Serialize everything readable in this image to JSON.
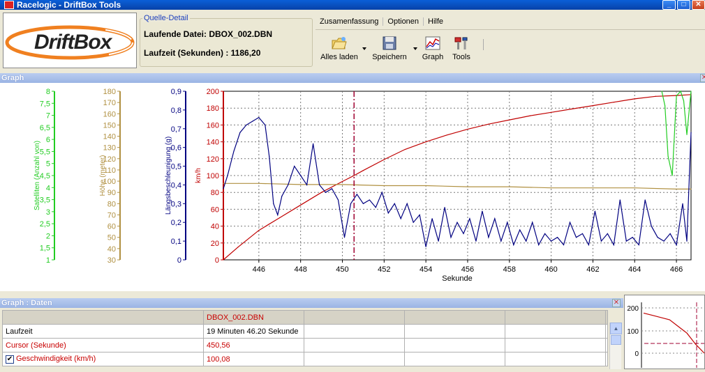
{
  "window": {
    "title": "Racelogic - DriftBox Tools",
    "min": "_",
    "max": "□",
    "close": "✕"
  },
  "logo": {
    "text": "DriftBox"
  },
  "quelle": {
    "legend": "Quelle-Detail",
    "file_line": "Laufende Datei: DBOX_002.DBN",
    "time_line": "Laufzeit (Sekunden) : 1186,20"
  },
  "menu": [
    "Zusamenfassung",
    "Optionen",
    "Hilfe"
  ],
  "toolbar": {
    "load": "Alles laden",
    "save": "Speichern",
    "graph": "Graph",
    "tools": "Tools",
    "load_icon": "folder-icon",
    "save_icon": "floppy-icon",
    "graph_icon": "graph-icon",
    "tools_icon": "tools-icon"
  },
  "graph_panel": {
    "title": "Graph",
    "close": "✕"
  },
  "daten_panel": {
    "title": "Graph : Daten",
    "close": "✕"
  },
  "colors": {
    "satellites": "#22cc22",
    "height": "#b09040",
    "accel": "#000080",
    "speed": "#c00000"
  },
  "chart_data": {
    "type": "line",
    "xlabel": "Sekunde",
    "xlim": [
      444.3,
      466.7
    ],
    "x_ticks": [
      "446",
      "448",
      "450",
      "452",
      "454",
      "456",
      "458",
      "460",
      "462",
      "464",
      "466"
    ],
    "cursor_x": 450.56,
    "axes": [
      {
        "name": "Satelliten (Anzahl von)",
        "color": "#22cc22",
        "ylim": [
          1,
          8
        ],
        "ticks": [
          "1",
          "1,5",
          "2",
          "2,5",
          "3",
          "3,5",
          "4",
          "4,5",
          "5",
          "5,5",
          "6",
          "6,5",
          "7",
          "7,5",
          "8"
        ]
      },
      {
        "name": "Höhe (meter)",
        "color": "#b09040",
        "ylim": [
          30,
          180
        ],
        "ticks": [
          "30",
          "40",
          "50",
          "60",
          "70",
          "80",
          "90",
          "100",
          "110",
          "120",
          "130",
          "140",
          "150",
          "160",
          "170",
          "180"
        ]
      },
      {
        "name": "Längsbeschleunigung (g)",
        "color": "#000080",
        "ylim": [
          0,
          0.9
        ],
        "ticks": [
          "0",
          "0,1",
          "0,2",
          "0,3",
          "0,4",
          "0,5",
          "0,6",
          "0,7",
          "0,8",
          "0,9"
        ]
      },
      {
        "name": "km/h",
        "color": "#c00000",
        "ylim": [
          0,
          200
        ],
        "ticks": [
          "0",
          "20",
          "40",
          "60",
          "80",
          "100",
          "120",
          "140",
          "160",
          "180",
          "200"
        ]
      }
    ],
    "series": [
      {
        "name": "Geschwindigkeit",
        "axis": 3,
        "color": "#c00000",
        "x": [
          444.3,
          445,
          446,
          447,
          448,
          449,
          450,
          450.56,
          451,
          452,
          453,
          454,
          455,
          456,
          457,
          458,
          459,
          460,
          461,
          462,
          463,
          464,
          465,
          466,
          466.7
        ],
        "y": [
          0,
          15,
          35,
          50,
          65,
          80,
          93,
          100,
          106,
          119,
          131,
          140,
          148,
          155,
          161,
          166,
          171,
          175,
          179,
          183,
          187,
          191,
          194,
          195,
          196
        ]
      },
      {
        "name": "Höhe",
        "axis": 1,
        "color": "#b09040",
        "x": [
          444.3,
          446,
          448,
          450,
          452,
          454,
          456,
          458,
          460,
          462,
          464,
          466,
          466.7
        ],
        "y": [
          98,
          98,
          97,
          97,
          96,
          96,
          95,
          95,
          94,
          94,
          94,
          93,
          93
        ]
      },
      {
        "name": "Satelliten",
        "axis": 0,
        "color": "#22cc22",
        "x": [
          465.3,
          465.45,
          465.6,
          465.8,
          466,
          466.2,
          466.35,
          466.5,
          466.7
        ],
        "y": [
          8,
          7.4,
          5.3,
          4.5,
          7.8,
          8,
          7.6,
          6.2,
          8
        ]
      },
      {
        "name": "Längsbeschleunigung",
        "axis": 2,
        "color": "#000080",
        "x": [
          444.3,
          444.5,
          444.8,
          445.1,
          445.4,
          445.7,
          446,
          446.3,
          446.5,
          446.7,
          446.9,
          447.1,
          447.4,
          447.7,
          448,
          448.3,
          448.6,
          448.9,
          449.2,
          449.5,
          449.8,
          450.1,
          450.4,
          450.7,
          451,
          451.3,
          451.6,
          451.9,
          452.2,
          452.5,
          452.8,
          453.1,
          453.4,
          453.7,
          454,
          454.3,
          454.6,
          454.9,
          455.2,
          455.5,
          455.8,
          456.1,
          456.4,
          456.7,
          457,
          457.3,
          457.6,
          457.9,
          458.2,
          458.5,
          458.8,
          459.1,
          459.4,
          459.7,
          460,
          460.3,
          460.6,
          460.9,
          461.2,
          461.5,
          461.8,
          462.1,
          462.4,
          462.7,
          463,
          463.3,
          463.6,
          463.9,
          464.2,
          464.5,
          464.8,
          465.1,
          465.4,
          465.7,
          466,
          466.3,
          466.5,
          466.7
        ],
        "y": [
          0.38,
          0.45,
          0.58,
          0.68,
          0.72,
          0.74,
          0.76,
          0.72,
          0.55,
          0.3,
          0.24,
          0.34,
          0.4,
          0.5,
          0.45,
          0.4,
          0.62,
          0.4,
          0.36,
          0.38,
          0.32,
          0.12,
          0.3,
          0.35,
          0.3,
          0.32,
          0.28,
          0.36,
          0.25,
          0.3,
          0.22,
          0.3,
          0.2,
          0.24,
          0.07,
          0.22,
          0.1,
          0.28,
          0.12,
          0.2,
          0.14,
          0.22,
          0.1,
          0.26,
          0.12,
          0.22,
          0.1,
          0.2,
          0.08,
          0.16,
          0.1,
          0.2,
          0.08,
          0.14,
          0.1,
          0.12,
          0.08,
          0.2,
          0.12,
          0.14,
          0.08,
          0.26,
          0.1,
          0.14,
          0.08,
          0.32,
          0.1,
          0.12,
          0.08,
          0.32,
          0.18,
          0.12,
          0.1,
          0.14,
          0.08,
          0.3,
          0.1,
          0.68
        ]
      }
    ]
  },
  "daten_table": {
    "header": [
      "",
      "DBOX_002.DBN",
      "",
      "",
      "",
      ""
    ],
    "rows": [
      {
        "label": "Laufzeit",
        "value": "19 Minuten 46.20 Sekunde",
        "red": false,
        "check": false
      },
      {
        "label": "Cursor (Sekunde)",
        "value": "450,56",
        "red": true,
        "check": false
      },
      {
        "label": "Geschwindigkeit (km/h)",
        "value": "100,08",
        "red": true,
        "check": true
      }
    ]
  },
  "mini_chart": {
    "ticks": [
      "200",
      "100",
      "0"
    ],
    "y": [
      180,
      170,
      160,
      150,
      120,
      90,
      40,
      0
    ]
  }
}
